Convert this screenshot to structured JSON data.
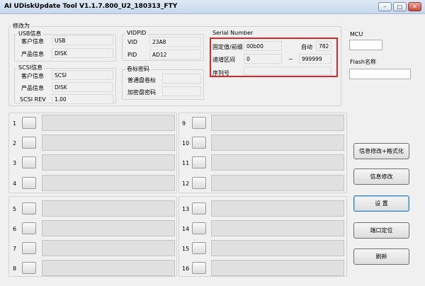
{
  "window": {
    "title": "AI UDiskUpdate Tool V1.1.7.800_U2_180313_FTY",
    "minimize_glyph": "–",
    "maximize_glyph": "□",
    "close_glyph": "✕"
  },
  "modify": {
    "legend": "修改为",
    "usb": {
      "legend": "USB信息",
      "customer_label": "客户信息",
      "customer_value": "USB",
      "product_label": "产品信息",
      "product_value": "DISK"
    },
    "scsi": {
      "legend": "SCSI信息",
      "customer_label": "客户信息",
      "customer_value": "SCSI",
      "product_label": "产品信息",
      "product_value": "DISK",
      "rev_label": "SCSI REV",
      "rev_value": "1.00"
    },
    "vidpid": {
      "legend": "VIDPID",
      "vid_label": "VID",
      "vid_value": "23A8",
      "pid_label": "PID",
      "pid_value": "AD12"
    },
    "volume": {
      "legend": "卷标密码",
      "normal_label": "普通盘卷标",
      "normal_value": "",
      "encrypted_label": "加密盘密码",
      "encrypted_value": ""
    },
    "serial": {
      "legend": "Serial Number",
      "prefix_label": "固定值/前缀",
      "prefix_value": "00b00",
      "auto_label": "自动",
      "auto_value": "782",
      "range_label": "递增区间",
      "range_start": "0",
      "range_sep": "~",
      "range_end": "999999",
      "serial_label": "序列号",
      "serial_value": ""
    }
  },
  "mcu": {
    "label": "MCU",
    "value": "",
    "flash_label": "Flash名称",
    "flash_value": ""
  },
  "slots": {
    "left_top": [
      "1",
      "2",
      "3",
      "4"
    ],
    "right_top": [
      "9",
      "10",
      "11",
      "12"
    ],
    "left_bottom": [
      "5",
      "6",
      "7",
      "8"
    ],
    "right_bottom": [
      "13",
      "14",
      "15",
      "16"
    ]
  },
  "actions": {
    "modify_format": "信息修改+格式化",
    "modify_info": "信息修改",
    "settings": "设 置",
    "port_locate": "端口定位",
    "refresh": "刷新"
  },
  "colors": {
    "highlight_border": "#d42a2a",
    "window_bg": "#f0f0f0",
    "slot_bar": "#e0e0e0"
  }
}
